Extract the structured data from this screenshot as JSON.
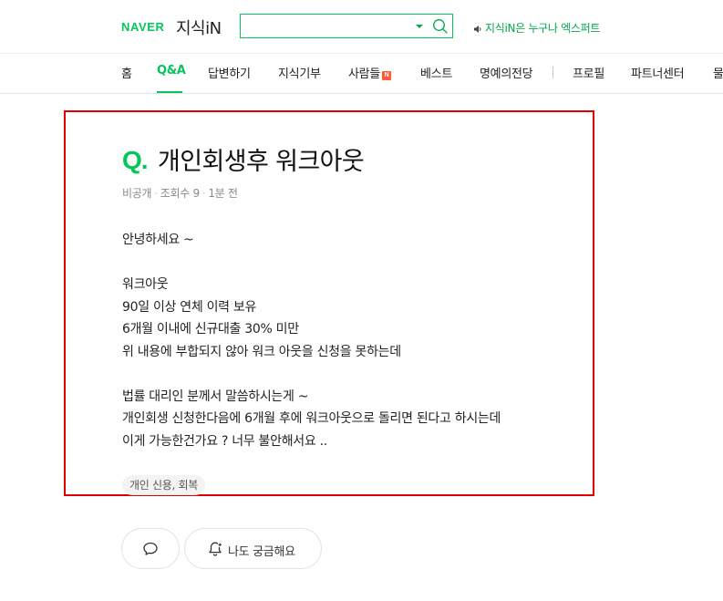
{
  "header": {
    "brand": "NAVER",
    "service": "지식iN",
    "search": {
      "value": "",
      "placeholder": ""
    },
    "promo": "지식iN은 누구나 엑스퍼트"
  },
  "nav": {
    "items": [
      {
        "label": "홈"
      },
      {
        "label": "Q&A",
        "active": true
      },
      {
        "label": "답변하기"
      },
      {
        "label": "지식기부"
      },
      {
        "label": "사람들",
        "badge": "N"
      },
      {
        "label": "베스트"
      },
      {
        "label": "명예의전당"
      },
      {
        "label": "프로필"
      },
      {
        "label": "파트너센터"
      },
      {
        "label": "물"
      }
    ]
  },
  "question": {
    "q_mark": "Q.",
    "title": "개인회생후 워크아웃",
    "meta": {
      "author": "비공개",
      "views": "조회수 9",
      "time": "1분 전"
    },
    "body": [
      "안녕하세요 ~",
      "",
      "워크아웃",
      "90일 이상 연체 이력 보유",
      "6개월 이내에 신규대출 30% 미만",
      "위 내용에 부합되지 않아 워크 아웃을 신청을 못하는데",
      "",
      "법률 대리인 분께서 말씀하시는게 ~",
      "개인회생 신청한다음에  6개월 후에 워크아웃으로 돌리면 된다고 하시는데",
      "이게 가능한건가요 ?  너무 불안해서요 .."
    ],
    "tag": "개인 신용, 회복"
  },
  "actions": {
    "curious_label": "나도 궁금해요"
  },
  "colors": {
    "brand": "#03c75a",
    "highlight_border": "#e00000",
    "badge": "#ff5a3a"
  }
}
